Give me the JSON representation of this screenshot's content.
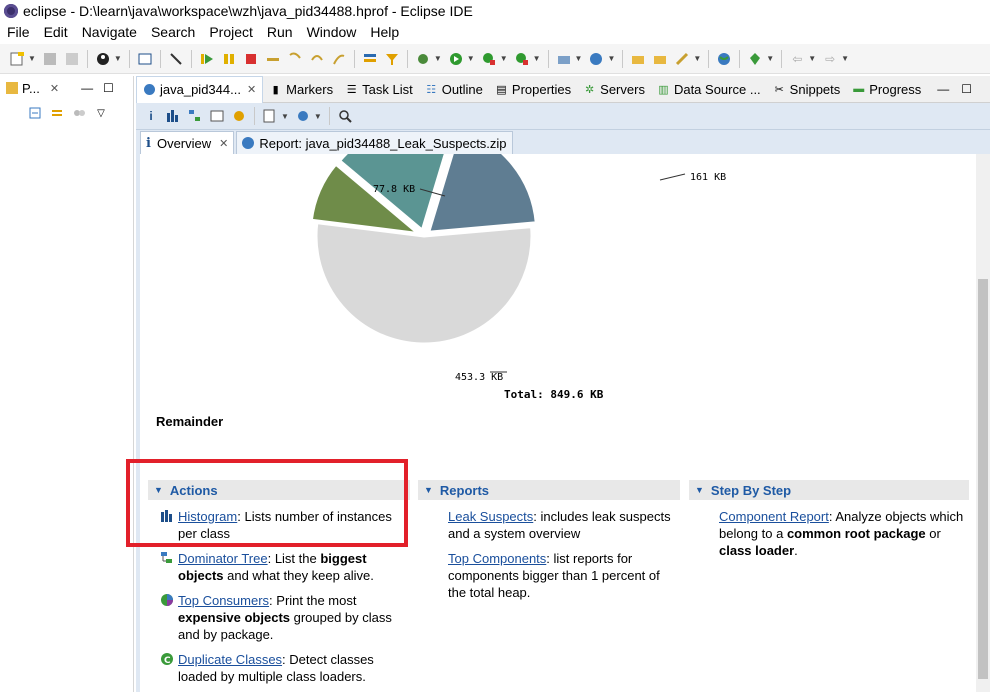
{
  "window": {
    "title": "eclipse - D:\\learn\\java\\workspace\\wzh\\java_pid34488.hprof - Eclipse IDE"
  },
  "menu": [
    "File",
    "Edit",
    "Navigate",
    "Search",
    "Project",
    "Run",
    "Window",
    "Help"
  ],
  "left_panel": {
    "tab_label": "P..."
  },
  "view_tabs": [
    {
      "label": "java_pid344..."
    },
    {
      "label": "Markers"
    },
    {
      "label": "Task List"
    },
    {
      "label": "Outline"
    },
    {
      "label": "Properties"
    },
    {
      "label": "Servers"
    },
    {
      "label": "Data Source ..."
    },
    {
      "label": "Snippets"
    },
    {
      "label": "Progress"
    }
  ],
  "inner_tabs": [
    {
      "label": "Overview"
    },
    {
      "label": "Report: java_pid34488_Leak_Suspects.zip"
    }
  ],
  "pie": {
    "labels": [
      "77.8 KB",
      "161 KB",
      "453.3 KB"
    ],
    "total": "Total: 849.6 KB",
    "slices": [
      {
        "value_kb": 453.3,
        "color": "#d9d9d9"
      },
      {
        "value_kb": 77.8,
        "color": "#6f8c49"
      },
      {
        "value_kb": 157.5,
        "color": "#5b9593"
      },
      {
        "value_kb": 161,
        "color": "#5f7d92"
      }
    ]
  },
  "remainder_label": "Remainder",
  "sections": {
    "actions": {
      "title": "Actions",
      "entries": [
        {
          "link": "Histogram",
          "text": ": Lists number of instances per class"
        },
        {
          "link": "Dominator Tree",
          "text1": ": List the ",
          "bold1": "biggest objects",
          "text2": " and what they keep alive."
        },
        {
          "link": "Top Consumers",
          "text1": ": Print the most ",
          "bold1": "expensive objects",
          "text2": " grouped by class and by package."
        },
        {
          "link": "Duplicate Classes",
          "text": ": Detect classes loaded by multiple class loaders."
        }
      ]
    },
    "reports": {
      "title": "Reports",
      "entries": [
        {
          "link": "Leak Suspects",
          "text": ": includes leak suspects and a system overview"
        },
        {
          "link": "Top Components",
          "text": ": list reports for components bigger than 1 percent of the total heap."
        }
      ]
    },
    "stepbystep": {
      "title": "Step By Step",
      "entry": {
        "link": "Component Report",
        "text1": ": Analyze objects which belong to a ",
        "bold1": "common root package",
        "text2": " or ",
        "bold2": "class loader",
        "text3": "."
      }
    }
  },
  "colors": {
    "highlight": "#e2202a",
    "link": "#1a4f9c",
    "section_title": "#1f5aa5"
  }
}
